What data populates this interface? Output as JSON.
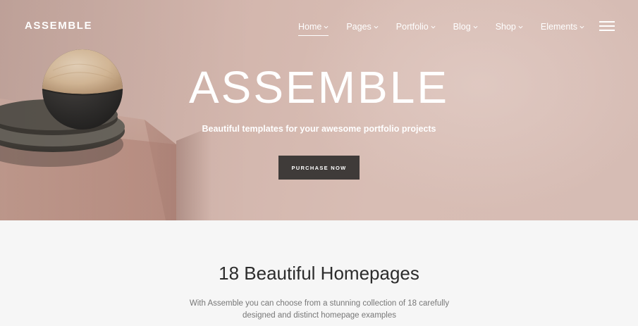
{
  "header": {
    "logo": "ASSEMBLE",
    "nav": [
      {
        "label": "Home",
        "active": true
      },
      {
        "label": "Pages"
      },
      {
        "label": "Portfolio"
      },
      {
        "label": "Blog"
      },
      {
        "label": "Shop"
      },
      {
        "label": "Elements"
      }
    ],
    "menu_icon": "hamburger-menu-icon"
  },
  "hero": {
    "title": "ASSEMBLE",
    "subtitle": "Beautiful templates for your awesome portfolio projects",
    "cta_label": "PURCHASE NOW"
  },
  "section": {
    "title": "18 Beautiful Homepages",
    "description": "With Assemble you can choose from a stunning collection of 18 carefully designed and distinct homepage examples"
  },
  "colors": {
    "hero_bg": "#d3b6ad",
    "button_bg": "#3f3b39",
    "section_bg": "#f6f6f6"
  }
}
